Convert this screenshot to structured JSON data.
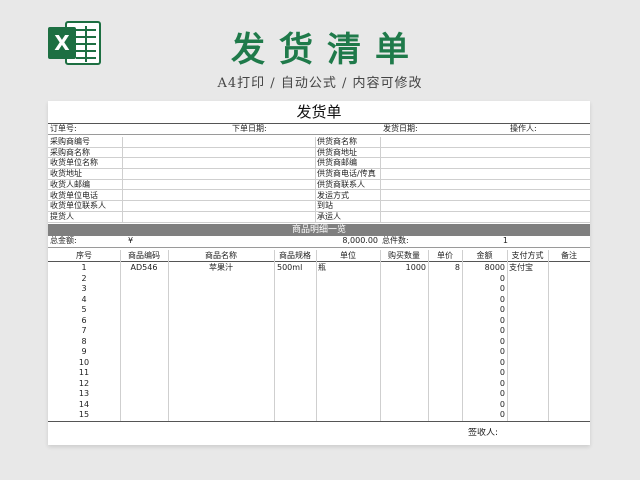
{
  "banner": {
    "title": "发货清单",
    "subtitle": "A4打印 / 自动公式 / 内容可修改",
    "logo_letter": "X",
    "logo_color": "#1d6f42"
  },
  "sheet": {
    "title": "发货单",
    "order_row": {
      "order_no": "订单号:",
      "order_date": "下单日期:",
      "ship_date": "发货日期:",
      "operator": "操作人:"
    },
    "info_left": [
      "采购商编号",
      "采购商名称",
      "收货单位名称",
      "收货地址",
      "收货人邮编",
      "收货单位电话",
      "收货单位联系人",
      "提货人"
    ],
    "info_right": [
      "供货商名称",
      "供货商地址",
      "供货商邮编",
      "供货商电话/传真",
      "供货商联系人",
      "发运方式",
      "到站",
      "承运人"
    ],
    "detail_bar": "商品明细一览",
    "total": {
      "label": "总金额:",
      "currency": "¥",
      "amount": "8,000.00",
      "count_label": "总件数:",
      "count": "1"
    },
    "columns": [
      "序号",
      "商品编码",
      "商品名称",
      "商品规格",
      "单位",
      "购买数量",
      "单价",
      "金额",
      "支付方式",
      "备注"
    ],
    "first_item": {
      "no": "1",
      "code": "AD546",
      "name": "苹果汁",
      "spec": "500ml",
      "unit": "瓶",
      "qty": "1000",
      "price": "8",
      "amount": "8000",
      "pay": "支付宝"
    },
    "rows": [
      "2",
      "3",
      "4",
      "5",
      "6",
      "7",
      "8",
      "9",
      "10",
      "11",
      "12",
      "13",
      "14",
      "15"
    ],
    "zero": "0",
    "signer": "签收人:"
  }
}
